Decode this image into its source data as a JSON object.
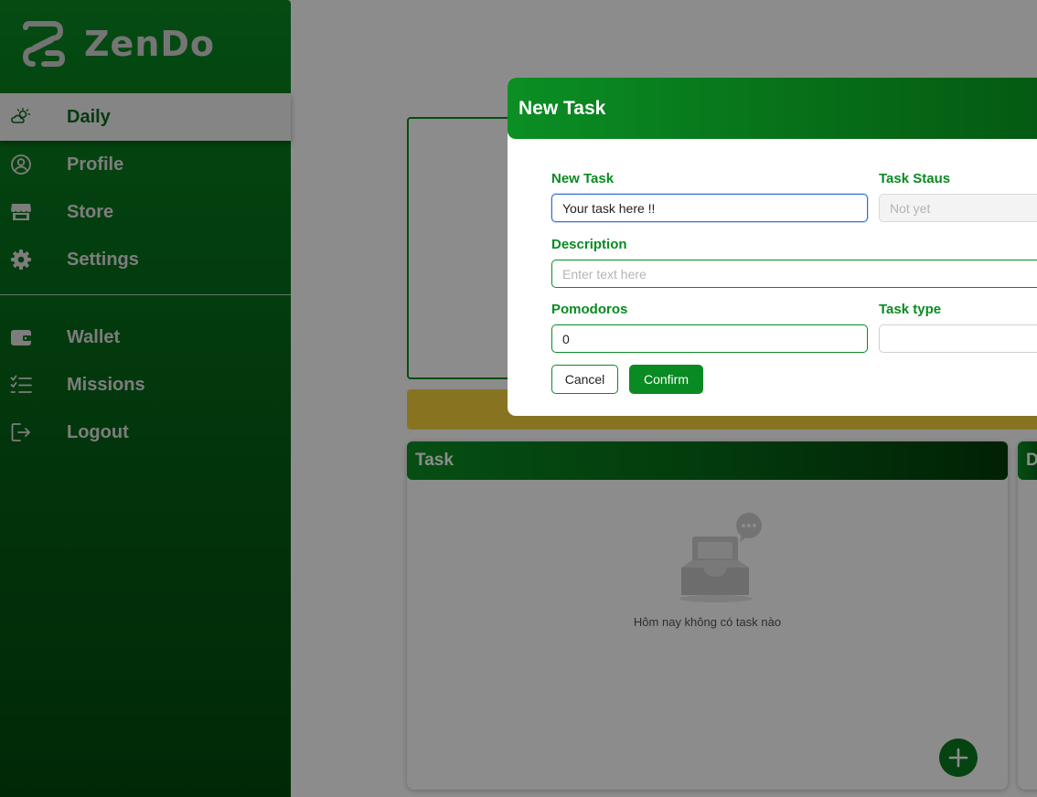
{
  "app": {
    "name": "ZenDo"
  },
  "sidebar": {
    "items": [
      {
        "label": "Daily",
        "icon": "sun-cloud-icon",
        "active": true
      },
      {
        "label": "Profile",
        "icon": "user-circle-icon"
      },
      {
        "label": "Store",
        "icon": "store-icon"
      },
      {
        "label": "Settings",
        "icon": "gear-icon"
      },
      {
        "label": "Wallet",
        "icon": "wallet-icon"
      },
      {
        "label": "Missions",
        "icon": "checklist-icon"
      },
      {
        "label": "Logout",
        "icon": "logout-icon"
      }
    ]
  },
  "main": {
    "task_panel": {
      "title": "Task",
      "empty_message": "Hôm nay không có task nào"
    },
    "second_panel": {
      "title": "D"
    }
  },
  "modal": {
    "title": "New Task",
    "fields": {
      "task": {
        "label": "New Task",
        "value": "Your task here !!"
      },
      "status": {
        "label": "Task Staus",
        "placeholder": "Not yet"
      },
      "description": {
        "label": "Description",
        "placeholder": "Enter text here"
      },
      "pomodoros": {
        "label": "Pomodoros",
        "value": "0"
      },
      "task_type": {
        "label": "Task type",
        "value": ""
      }
    },
    "buttons": {
      "cancel": "Cancel",
      "confirm": "Confirm"
    }
  },
  "colors": {
    "brand_green": "#0a8a22",
    "accent_yellow": "#f7d43b",
    "focus_blue": "#2f6fd6"
  }
}
